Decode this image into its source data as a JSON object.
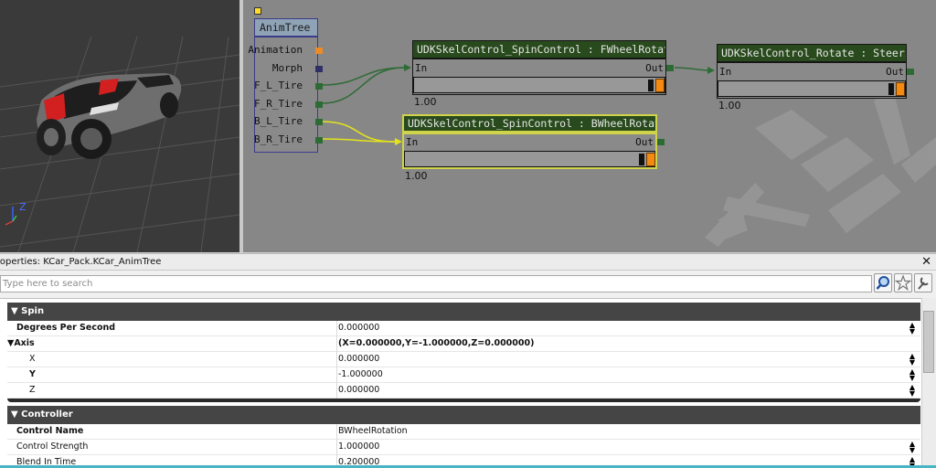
{
  "animtree": {
    "title": "AnimTree",
    "outputs": [
      "Animation",
      "Morph",
      "F_L_Tire",
      "F_R_Tire",
      "B_L_Tire",
      "B_R_Tire"
    ]
  },
  "nodes": {
    "front_spin": {
      "title": "UDKSkelControl_SpinControl : FWheelRotation",
      "in_label": "In",
      "out_label": "Out",
      "strength": "1.00"
    },
    "rear_spin": {
      "title": "UDKSkelControl_SpinControl : BWheelRotation",
      "in_label": "In",
      "out_label": "Out",
      "strength": "1.00"
    },
    "steering": {
      "title": "UDKSkelControl_Rotate : Steering",
      "in_label": "In",
      "out_label": "Out",
      "strength": "1.00"
    }
  },
  "viewport": {
    "axis_z": "Z"
  },
  "properties": {
    "title": "roperties: KCar_Pack.KCar_AnimTree",
    "close_glyph": "✕",
    "search_placeholder": "Type here to search",
    "categories": {
      "spin": {
        "label": "Spin",
        "rows": {
          "degrees": {
            "name": "Degrees Per Second",
            "value": "0.000000"
          },
          "axis": {
            "name": "Axis",
            "value": "(X=0.000000,Y=-1.000000,Z=0.000000)"
          },
          "x": {
            "name": "X",
            "value": "0.000000"
          },
          "y": {
            "name": "Y",
            "value": "-1.000000"
          },
          "z": {
            "name": "Z",
            "value": "0.000000"
          }
        }
      },
      "controller": {
        "label": "Controller",
        "rows": {
          "name": {
            "name": "Control Name",
            "value": "BWheelRotation"
          },
          "strength": {
            "name": "Control Strength",
            "value": "1.000000"
          },
          "blend": {
            "name": "Blend In Time",
            "value": "0.200000"
          }
        }
      }
    }
  },
  "colors": {
    "node_title": "#284a1c",
    "selection": "#cfd44a",
    "link": "#2c6b34",
    "accent": "#f48a11"
  }
}
